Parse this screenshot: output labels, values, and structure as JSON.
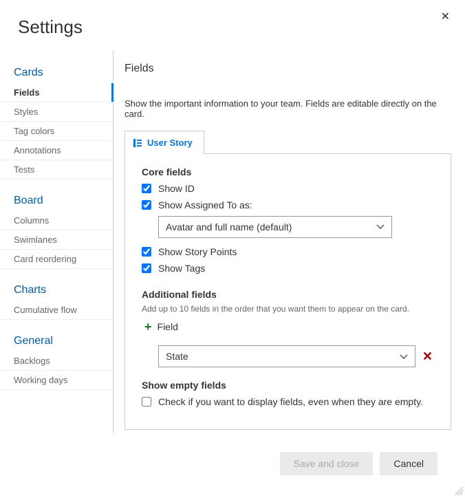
{
  "title": "Settings",
  "sidebar": {
    "groups": [
      {
        "title": "Cards",
        "items": [
          "Fields",
          "Styles",
          "Tag colors",
          "Annotations",
          "Tests"
        ],
        "selected": "Fields"
      },
      {
        "title": "Board",
        "items": [
          "Columns",
          "Swimlanes",
          "Card reordering"
        ]
      },
      {
        "title": "Charts",
        "items": [
          "Cumulative flow"
        ]
      },
      {
        "title": "General",
        "items": [
          "Backlogs",
          "Working days"
        ]
      }
    ]
  },
  "main": {
    "heading": "Fields",
    "description": "Show the important information to your team. Fields are editable directly on the card.",
    "tab_label": "User Story",
    "core_fields": {
      "heading": "Core fields",
      "show_id": {
        "label": "Show ID",
        "checked": true
      },
      "assigned_to": {
        "label": "Show Assigned To as:",
        "checked": true,
        "value": "Avatar and full name (default)"
      },
      "story_points": {
        "label": "Show Story Points",
        "checked": true
      },
      "show_tags": {
        "label": "Show Tags",
        "checked": true
      }
    },
    "additional": {
      "heading": "Additional fields",
      "subtext": "Add up to 10 fields in the order that you want them to appear on the card.",
      "add_label": "Field",
      "field_value": "State"
    },
    "empty": {
      "heading": "Show empty fields",
      "label": "Check if you want to display fields, even when they are empty.",
      "checked": false
    }
  },
  "buttons": {
    "save": "Save and close",
    "cancel": "Cancel"
  }
}
